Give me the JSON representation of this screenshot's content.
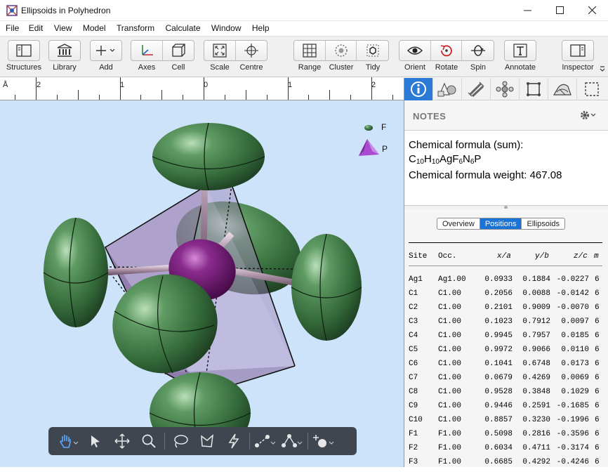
{
  "window": {
    "title": "Ellipsoids in Polyhedron",
    "controls": [
      "minimize",
      "maximize",
      "close"
    ]
  },
  "menu": [
    "File",
    "Edit",
    "View",
    "Model",
    "Transform",
    "Calculate",
    "Window",
    "Help"
  ],
  "toolbar": {
    "structures": "Structures",
    "library": "Library",
    "add": "Add",
    "axes": "Axes",
    "cell": "Cell",
    "scale": "Scale",
    "centre": "Centre",
    "range": "Range",
    "cluster": "Cluster",
    "tidy": "Tidy",
    "orient": "Orient",
    "rotate": "Rotate",
    "spin": "Spin",
    "annotate": "Annotate",
    "inspector": "Inspector"
  },
  "ruler": {
    "unit": "Å",
    "labels": [
      "2",
      "1",
      "0",
      "1",
      "2"
    ]
  },
  "legend": [
    {
      "label": "F",
      "color": "#3f7a45"
    },
    {
      "label": "P",
      "color": "#a94ccf"
    }
  ],
  "colors": {
    "accent": "#2a7ad6",
    "ellipsoid": "#3d7443",
    "polyhedron": "#9d7fb5",
    "silver": "#5c0f5f",
    "background": "#cde3f9"
  },
  "inspector": {
    "notes_title": "NOTES",
    "notes": {
      "line1": "Chemical formula (sum):",
      "formula": [
        {
          "t": "C"
        },
        {
          "s": "10"
        },
        {
          "t": "H"
        },
        {
          "s": "10"
        },
        {
          "t": "AgF"
        },
        {
          "s": "6"
        },
        {
          "t": "N"
        },
        {
          "s": "6"
        },
        {
          "t": "P"
        }
      ],
      "line3": "Chemical formula weight: 467.08"
    },
    "tabs": [
      "Overview",
      "Positions",
      "Ellipsoids"
    ],
    "active_tab": "Positions",
    "table": {
      "headers": [
        "Site",
        "Occ.",
        "x/a",
        "y/b",
        "z/c",
        "m"
      ],
      "rows": [
        [
          "Ag1",
          "Ag1.00",
          "0.0933",
          "0.1884",
          "-0.0227",
          "6"
        ],
        [
          "C1",
          "C1.00",
          "0.2056",
          "0.0088",
          "-0.0142",
          "6"
        ],
        [
          "C2",
          "C1.00",
          "0.2101",
          "0.9009",
          "-0.0070",
          "6"
        ],
        [
          "C3",
          "C1.00",
          "0.1023",
          "0.7912",
          "0.0097",
          "6"
        ],
        [
          "C4",
          "C1.00",
          "0.9945",
          "0.7957",
          "0.0185",
          "6"
        ],
        [
          "C5",
          "C1.00",
          "0.9972",
          "0.9066",
          "0.0110",
          "6"
        ],
        [
          "C6",
          "C1.00",
          "0.1041",
          "0.6748",
          "0.0173",
          "6"
        ],
        [
          "C7",
          "C1.00",
          "0.0679",
          "0.4269",
          "0.0069",
          "6"
        ],
        [
          "C8",
          "C1.00",
          "0.9528",
          "0.3848",
          "0.1029",
          "6"
        ],
        [
          "C9",
          "C1.00",
          "0.9446",
          "0.2591",
          "-0.1685",
          "6"
        ],
        [
          "C10",
          "C1.00",
          "0.8857",
          "0.3230",
          "-0.1996",
          "6"
        ],
        [
          "F1",
          "F1.00",
          "0.5098",
          "0.2816",
          "-0.3596",
          "6"
        ],
        [
          "F2",
          "F1.00",
          "0.6034",
          "0.4711",
          "-0.3174",
          "6"
        ],
        [
          "F3",
          "F1.00",
          "0.6685",
          "0.4292",
          "-0.4246",
          "6"
        ]
      ]
    }
  }
}
